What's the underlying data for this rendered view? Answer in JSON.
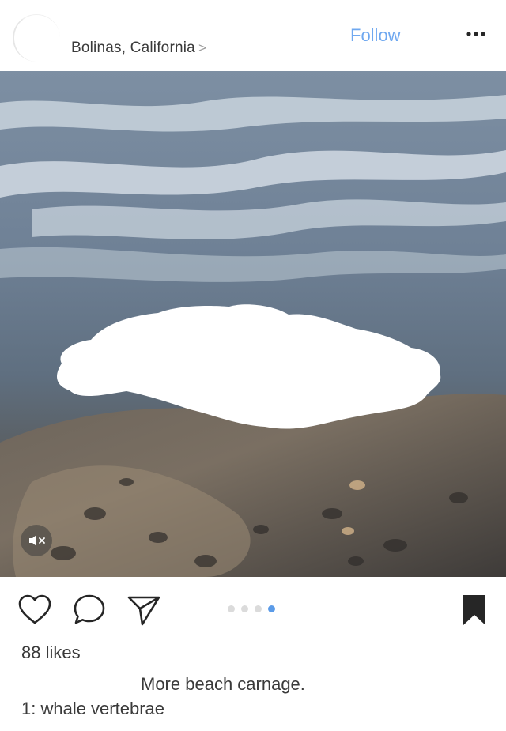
{
  "header": {
    "location": "Bolinas, California",
    "location_chevron": ">",
    "follow_label": "Follow",
    "more_icon": "more-horizontal-icon"
  },
  "media": {
    "type": "video",
    "muted": true,
    "mute_icon": "speaker-muted-icon"
  },
  "actions": {
    "icons": [
      "heart-icon",
      "comment-icon",
      "share-icon",
      "bookmark-icon"
    ],
    "carousel": {
      "count": 4,
      "active_index": 3
    }
  },
  "post": {
    "likes": "88 likes",
    "caption_line1": "More beach carnage.",
    "caption_line2": "1: whale vertebrae"
  },
  "colors": {
    "follow": "#6fa8f0",
    "active_dot": "#5b9be8",
    "inactive_dot": "#dbdbdb",
    "text": "#3a3a3a"
  }
}
